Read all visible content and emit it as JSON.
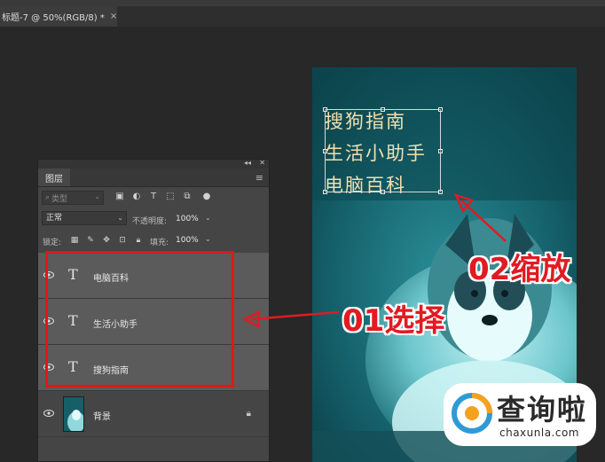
{
  "document_tab": {
    "title": "标题-7 @ 50%(RGB/8) *",
    "close": "×"
  },
  "photo": {
    "text_lines": [
      "搜狗指南",
      "生活小助手",
      "电脑百科"
    ]
  },
  "panel": {
    "tab": "图层",
    "filter_placeholder": "类型",
    "blend_mode": "正常",
    "opacity_label": "不透明度:",
    "opacity_value": "100%",
    "lock_label": "锁定:",
    "fill_label": "填充:",
    "fill_value": "100%",
    "layers": [
      {
        "name": "电脑百科",
        "type": "text",
        "visible": true
      },
      {
        "name": "生活小助手",
        "type": "text",
        "visible": true
      },
      {
        "name": "搜狗指南",
        "type": "text",
        "visible": true
      },
      {
        "name": "背景",
        "type": "image",
        "visible": true,
        "locked": true
      }
    ]
  },
  "annotations": {
    "select": "01选择",
    "scale": "02缩放",
    "color": "#e21a22"
  },
  "watermark": {
    "cn": "查询啦",
    "en": "chaxunla.com"
  }
}
